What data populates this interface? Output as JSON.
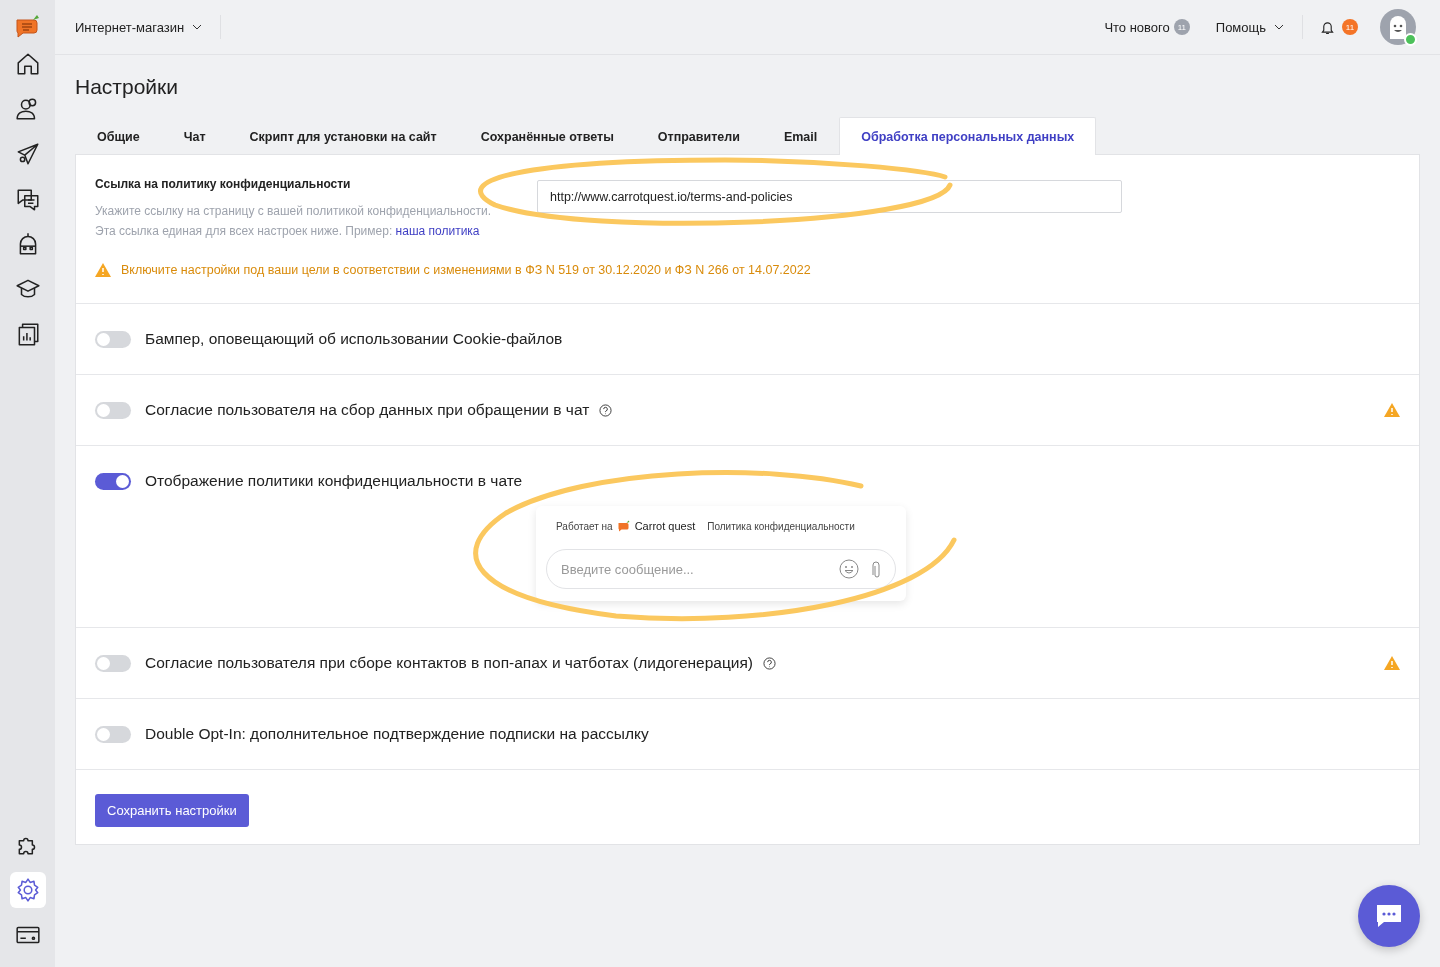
{
  "sidebar": {
    "top_items": [
      {
        "selected": false
      },
      {
        "selected": false
      },
      {
        "selected": false
      },
      {
        "selected": false
      },
      {
        "selected": false
      },
      {
        "selected": false
      },
      {
        "selected": false
      }
    ],
    "bottom_items": [
      {
        "selected": false
      },
      {
        "selected": true
      },
      {
        "selected": false
      }
    ]
  },
  "topbar": {
    "project": "Интернет-магазин",
    "whats_new": "Что нового",
    "whats_new_count": "11",
    "help": "Помощь",
    "notifications_count": "11"
  },
  "page_title": "Настройки",
  "tabs": [
    {
      "label": "Общие",
      "selected": false
    },
    {
      "label": "Чат",
      "selected": false
    },
    {
      "label": "Скрипт для установки на сайт",
      "selected": false
    },
    {
      "label": "Сохранённые ответы",
      "selected": false
    },
    {
      "label": "Отправители",
      "selected": false
    },
    {
      "label": "Email",
      "selected": false
    },
    {
      "label": "Обработка персональных данных",
      "selected": true
    }
  ],
  "policy": {
    "title": "Ссылка на политику конфиденциальности",
    "description": "Укажите ссылку на страницу с вашей политикой конфиденциальности. Эта ссылка единая для всех настроек ниже. Пример:",
    "example_link": "наша политика",
    "url": "http://www.carrotquest.io/terms-and-policies",
    "warning": "Включите настройки под ваши цели в соответствии с изменениями в ФЗ N 519 от 30.12.2020 и ФЗ N 266 от 14.07.2022"
  },
  "settings": [
    {
      "label": "Бампер, оповещающий об использовании Cookie-файлов",
      "on": false,
      "help": false,
      "warning": false
    },
    {
      "label": "Согласие пользователя на сбор данных при обращении в чат",
      "on": false,
      "help": true,
      "warning": true
    },
    {
      "label": "Отображение политики конфиденциальности в чате",
      "on": true,
      "help": false,
      "warning": false,
      "preview": {
        "powered_by": "Работает на",
        "brand": "Carrot quest",
        "policy_link": "Политика конфиденциальности",
        "placeholder": "Введите сообщение..."
      }
    },
    {
      "label": "Согласие пользователя при сборе контактов в поп-апах и чатботах (лидогенерация)",
      "on": false,
      "help": true,
      "warning": true
    },
    {
      "label": "Double Opt-In: дополнительное подтверждение подписки на рассылку",
      "on": false,
      "help": false,
      "warning": false
    }
  ],
  "save_button": "Сохранить настройки"
}
